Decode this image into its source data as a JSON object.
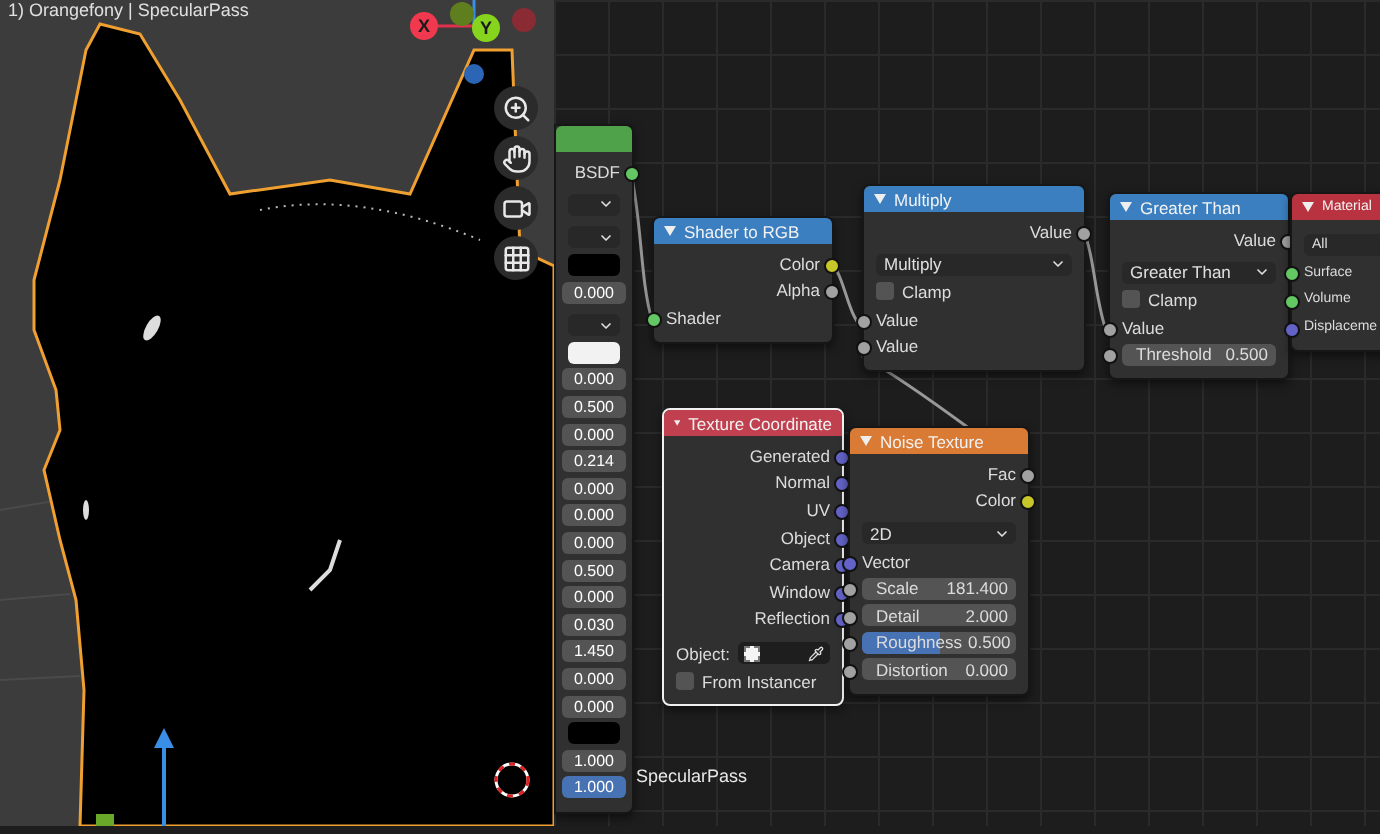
{
  "viewport": {
    "title": "1) Orangefony | SpecularPass",
    "gizmo": {
      "x_label": "X",
      "y_label": "Y"
    }
  },
  "node_editor": {
    "floating_label": "SpecularPass",
    "nodes": [
      {
        "color": "#4fa24a",
        "selected": false,
        "rows": [
          {
            "kind": "output",
            "label": "BSDF",
            "color": "#63c763"
          },
          {
            "kind": "dropdown"
          },
          {
            "kind": "dropdown"
          },
          {
            "kind": "swatch",
            "color": "#000000"
          },
          {
            "kind": "value",
            "value": "0.000",
            "highlighted": false
          },
          {
            "kind": "dropdown"
          },
          {
            "kind": "swatch",
            "color": "#f2f2f2"
          },
          {
            "kind": "value",
            "value": "0.000",
            "highlighted": false
          },
          {
            "kind": "value",
            "value": "0.500",
            "highlighted": false
          },
          {
            "kind": "value",
            "value": "0.000",
            "highlighted": false
          },
          {
            "kind": "value",
            "value": "0.214",
            "highlighted": false
          },
          {
            "kind": "value",
            "value": "0.000",
            "highlighted": false
          },
          {
            "kind": "value",
            "value": "0.000",
            "highlighted": false
          },
          {
            "kind": "value",
            "value": "0.000",
            "highlighted": false
          },
          {
            "kind": "value",
            "value": "0.500",
            "highlighted": false
          },
          {
            "kind": "value",
            "value": "0.000",
            "highlighted": false
          },
          {
            "kind": "value",
            "value": "0.030",
            "highlighted": false
          },
          {
            "kind": "value",
            "value": "1.450",
            "highlighted": false
          },
          {
            "kind": "value",
            "value": "0.000",
            "highlighted": false
          },
          {
            "kind": "value",
            "value": "0.000",
            "highlighted": false
          },
          {
            "kind": "swatch",
            "color": "#000000"
          },
          {
            "kind": "value",
            "value": "1.000",
            "highlighted": false
          },
          {
            "kind": "value",
            "value": "1.000",
            "highlighted": true
          }
        ]
      },
      {
        "title": "Shader to RGB",
        "color": "#3b7fc0",
        "selected": false,
        "rows": [
          {
            "kind": "output",
            "label": "Color",
            "color": "#c7c729"
          },
          {
            "kind": "output",
            "label": "Alpha",
            "color": "#a1a1a1"
          },
          {
            "kind": "input",
            "label": "Shader",
            "color": "#63c763"
          }
        ]
      },
      {
        "title": "Multiply",
        "color": "#3b7fc0",
        "selected": false,
        "rows": [
          {
            "kind": "output",
            "label": "Value",
            "color": "#a1a1a1"
          },
          {
            "kind": "dropdown",
            "value": "Multiply"
          },
          {
            "kind": "checkbox",
            "label": "Clamp",
            "checked": false
          },
          {
            "kind": "input",
            "label": "Value",
            "color": "#a1a1a1"
          },
          {
            "kind": "input",
            "label": "Value",
            "color": "#a1a1a1"
          }
        ]
      },
      {
        "title": "Greater Than",
        "color": "#3b7fc0",
        "selected": false,
        "rows": [
          {
            "kind": "output",
            "label": "Value",
            "color": "#a1a1a1"
          },
          {
            "kind": "dropdown",
            "value": "Greater Than"
          },
          {
            "kind": "checkbox",
            "label": "Clamp",
            "checked": false
          },
          {
            "kind": "input",
            "label": "Value",
            "color": "#a1a1a1"
          },
          {
            "kind": "field",
            "label": "Threshold",
            "value": "0.500",
            "color": "#a1a1a1"
          }
        ]
      },
      {
        "title": "Material",
        "color": "#b8323f",
        "selected": false,
        "rows": [
          {
            "kind": "dropdown",
            "value": "All"
          },
          {
            "kind": "input",
            "label": "Surface",
            "color": "#63c763"
          },
          {
            "kind": "input",
            "label": "Volume",
            "color": "#63c763"
          },
          {
            "kind": "input",
            "label": "Displaceme",
            "color": "#6363c7"
          }
        ]
      },
      {
        "title": "Texture Coordinate",
        "color": "#c0404f",
        "selected": true,
        "rows": [
          {
            "kind": "output",
            "label": "Generated",
            "color": "#6363c7"
          },
          {
            "kind": "output",
            "label": "Normal",
            "color": "#6363c7"
          },
          {
            "kind": "output",
            "label": "UV",
            "color": "#6363c7"
          },
          {
            "kind": "output",
            "label": "Object",
            "color": "#6363c7"
          },
          {
            "kind": "output",
            "label": "Camera",
            "color": "#6363c7"
          },
          {
            "kind": "output",
            "label": "Window",
            "color": "#6363c7"
          },
          {
            "kind": "output",
            "label": "Reflection",
            "color": "#6363c7"
          },
          {
            "kind": "object_field",
            "label": "Object:"
          },
          {
            "kind": "checkbox",
            "label": "From Instancer",
            "checked": false
          }
        ]
      },
      {
        "title": "Noise Texture",
        "color": "#d97a35",
        "selected": false,
        "rows": [
          {
            "kind": "output",
            "label": "Fac",
            "color": "#a1a1a1"
          },
          {
            "kind": "output",
            "label": "Color",
            "color": "#c7c729"
          },
          {
            "kind": "dropdown",
            "value": "2D"
          },
          {
            "kind": "input",
            "label": "Vector",
            "color": "#6363c7"
          },
          {
            "kind": "field",
            "label": "Scale",
            "value": "181.400",
            "color": "#a1a1a1"
          },
          {
            "kind": "field",
            "label": "Detail",
            "value": "2.000",
            "color": "#a1a1a1"
          },
          {
            "kind": "field",
            "label": "Roughness",
            "value": "0.500",
            "color": "#a1a1a1",
            "level": 0.5
          },
          {
            "kind": "field",
            "label": "Distortion",
            "value": "0.000",
            "color": "#a1a1a1"
          }
        ]
      }
    ]
  }
}
